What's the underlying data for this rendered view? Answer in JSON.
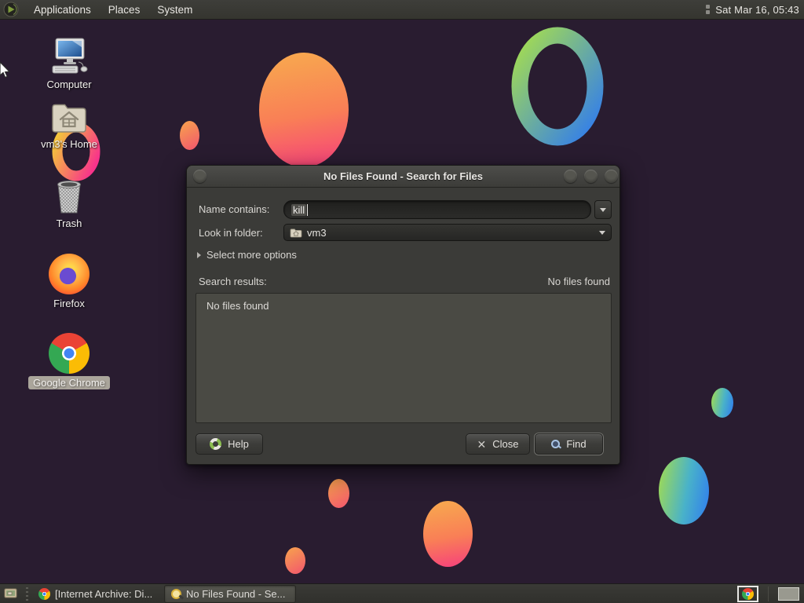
{
  "top_panel": {
    "menus": [
      {
        "label": "Applications"
      },
      {
        "label": "Places"
      },
      {
        "label": "System"
      }
    ],
    "clock": "Sat Mar 16, 05:43"
  },
  "desktop": {
    "icons": [
      {
        "id": "computer",
        "label": "Computer"
      },
      {
        "id": "home",
        "label": "vm3's Home"
      },
      {
        "id": "trash",
        "label": "Trash"
      },
      {
        "id": "firefox",
        "label": "Firefox"
      },
      {
        "id": "chrome",
        "label": "Google Chrome",
        "selected": true
      }
    ],
    "wallpaper_colors": {
      "background": "#291c30",
      "orange_gradient": [
        "#f8ab4e",
        "#f63f7d"
      ],
      "green_blue_gradient": [
        "#a5dd4c",
        "#2f7bf0"
      ],
      "ring_gradient": [
        "#f4c33c",
        "#f8328b"
      ]
    }
  },
  "dialog": {
    "title": "No Files Found - Search for Files",
    "name_contains": {
      "label": "Name contains:",
      "value": "kill"
    },
    "look_in_folder": {
      "label": "Look in folder:",
      "value": "vm3"
    },
    "expander": "Select more options",
    "search_results_label": "Search results:",
    "status": "No files found",
    "results_placeholder": "No files found",
    "buttons": {
      "help": "Help",
      "close": "Close",
      "find": "Find"
    }
  },
  "taskbar": {
    "items": [
      {
        "label": "[Internet Archive: Di...",
        "active": false
      },
      {
        "label": "No Files Found - Se...",
        "active": true
      }
    ]
  }
}
